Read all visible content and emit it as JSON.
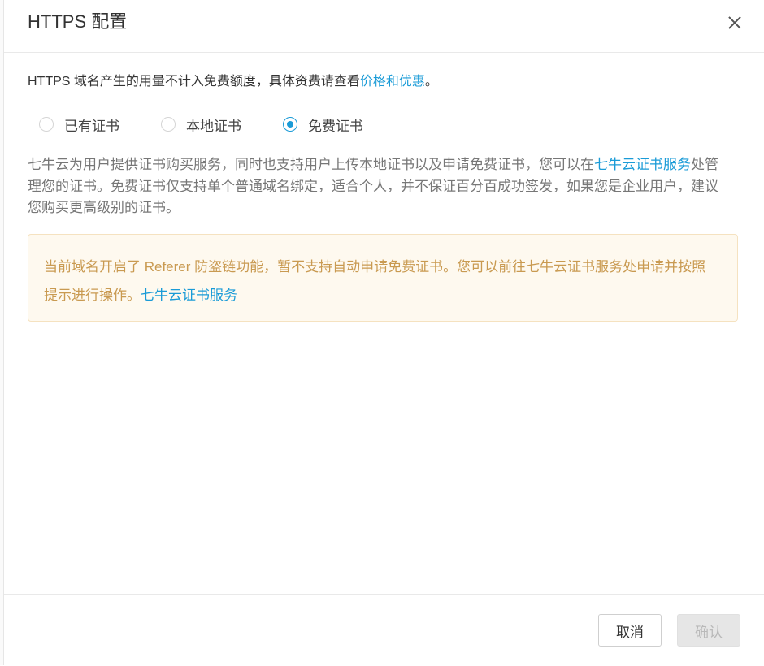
{
  "dialog": {
    "title": "HTTPS 配置"
  },
  "notice": {
    "text": "HTTPS 域名产生的用量不计入免费额度，具体资费请查看",
    "link": "价格和优惠",
    "suffix": "。"
  },
  "cert_options": {
    "selected": "免费证书",
    "items": [
      {
        "label": "已有证书",
        "checked": false
      },
      {
        "label": "本地证书",
        "checked": false
      },
      {
        "label": "免费证书",
        "checked": true
      }
    ]
  },
  "description": {
    "line1_text": "七牛云为用户提供证书购买服务，同时也支持用户上传本地证书以及申请免费证书，您可以在",
    "line1_link": "七牛云证书服务",
    "line1_suffix": "处管",
    "line2": "理您的证书。免费证书仅支持单个普通域名绑定，适合个人，并不保证百分百成功签发，如果您是企业用户，建议",
    "line3": "您购买更高级别的证书。"
  },
  "warning": {
    "line1": "当前域名开启了 Referer 防盗链功能，暂不支持自动申请免费证书。您可以前往七牛云证书服务处申请并按照",
    "line2_text": "提示进行操作。",
    "line2_link": "七牛云证书服务"
  },
  "footer": {
    "cancel_label": "取消",
    "confirm_label": "确认",
    "confirm_disabled": true
  },
  "colors": {
    "accent": "#1a9bd7",
    "warning_text": "#c99a51",
    "warning_bg": "#fef9ef"
  }
}
